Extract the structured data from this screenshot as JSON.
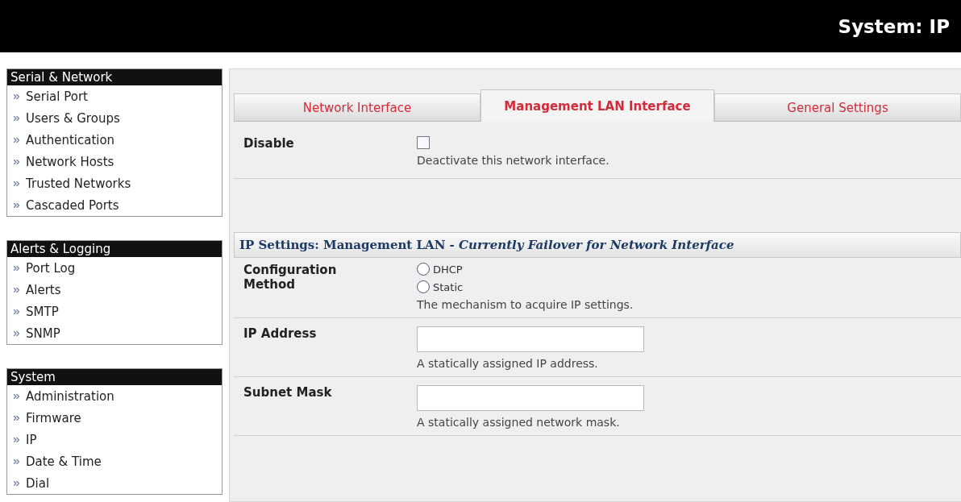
{
  "header": {
    "title": "System: IP"
  },
  "sidebar": [
    {
      "title": "Serial & Network",
      "items": [
        {
          "label": "Serial Port"
        },
        {
          "label": "Users & Groups"
        },
        {
          "label": "Authentication"
        },
        {
          "label": "Network Hosts"
        },
        {
          "label": "Trusted Networks"
        },
        {
          "label": "Cascaded Ports"
        }
      ]
    },
    {
      "title": "Alerts & Logging",
      "items": [
        {
          "label": "Port Log"
        },
        {
          "label": "Alerts"
        },
        {
          "label": "SMTP"
        },
        {
          "label": "SNMP"
        }
      ]
    },
    {
      "title": "System",
      "items": [
        {
          "label": "Administration"
        },
        {
          "label": "Firmware"
        },
        {
          "label": "IP"
        },
        {
          "label": "Date & Time"
        },
        {
          "label": "Dial"
        }
      ]
    }
  ],
  "tabs": [
    {
      "label": "Network Interface",
      "selected": false
    },
    {
      "label": "Management LAN Interface",
      "selected": true
    },
    {
      "label": "General Settings",
      "selected": false
    }
  ],
  "disable": {
    "label": "Disable",
    "checked": false,
    "help": "Deactivate this network interface."
  },
  "section": {
    "title": "IP Settings: Management LAN - *Currently Failover for Network Interface*"
  },
  "fields": [
    {
      "kind": "radio",
      "label": "Configuration Method",
      "options": [
        {
          "label": "DHCP",
          "selected": false
        },
        {
          "label": "Static",
          "selected": false
        }
      ],
      "help": "The mechanism to acquire IP settings."
    },
    {
      "kind": "text",
      "label": "IP Address",
      "help": "A statically assigned IP address."
    },
    {
      "kind": "text",
      "label": "Subnet Mask",
      "help": "A statically assigned network mask."
    }
  ]
}
